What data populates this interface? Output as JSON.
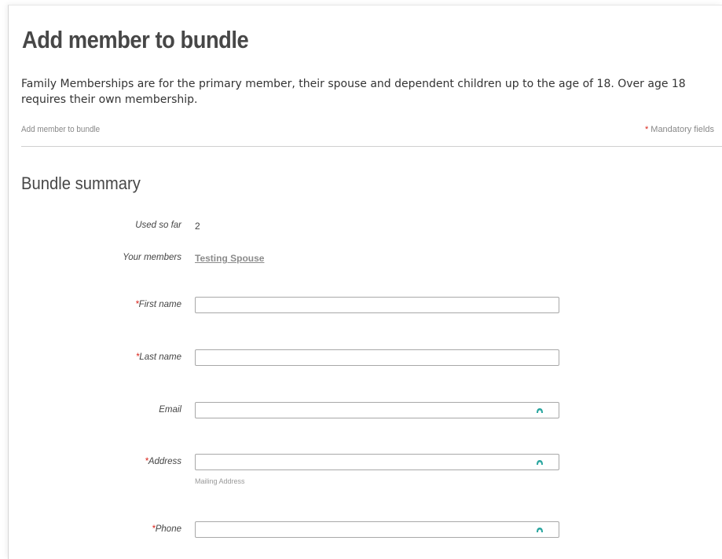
{
  "header": {
    "title": "Add member to bundle",
    "intro": "Family Memberships are for the primary member, their spouse and dependent children up to the age of 18.  Over age 18 requires their own membership.",
    "breadcrumb": "Add member to bundle",
    "mandatory_star": "*",
    "mandatory_label": "Mandatory fields"
  },
  "summary": {
    "title": "Bundle summary",
    "used_label": "Used so far",
    "used_value": "2",
    "members_label": "Your members",
    "member_link": "Testing Spouse"
  },
  "form": {
    "required_star": "*",
    "first_name_label": "First name",
    "first_name_value": "",
    "last_name_label": "Last name",
    "last_name_value": "",
    "email_label": "Email",
    "email_value": "",
    "address_label": "Address",
    "address_value": "",
    "address_hint": "Mailing Address",
    "phone_label": "Phone",
    "phone_value": ""
  },
  "colors": {
    "required": "#d9241b",
    "autofill_icon": "#2aa6a0",
    "title": "#474747"
  },
  "icons": {
    "autofill": "password-manager-icon"
  }
}
